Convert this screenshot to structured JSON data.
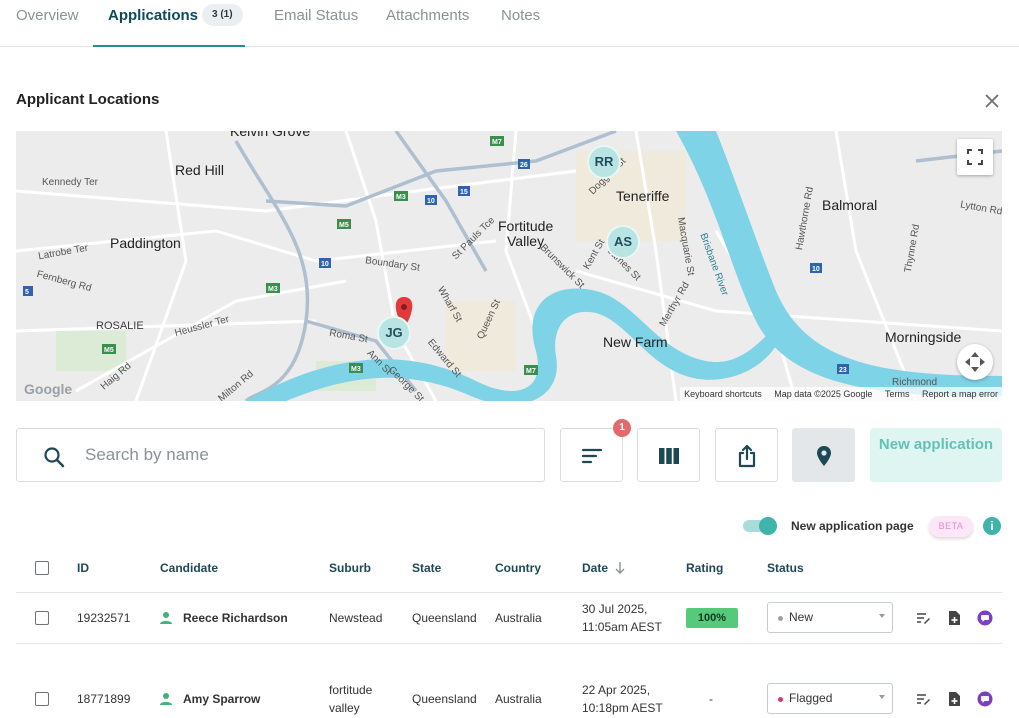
{
  "tabs": [
    {
      "label": "Overview"
    },
    {
      "label": "Applications",
      "badge": "3 (1)"
    },
    {
      "label": "Email Status"
    },
    {
      "label": "Attachments"
    },
    {
      "label": "Notes"
    }
  ],
  "section": {
    "title": "Applicant Locations"
  },
  "map": {
    "places": [
      "Kelvin Grove",
      "Red Hill",
      "Paddington",
      "ROSALIE",
      "Fortitude",
      "Valley",
      "Teneriffe",
      "New Farm",
      "Balmoral",
      "Morningside"
    ],
    "streets": [
      "Kennedy Ter",
      "Latrobe Ter",
      "Fernberg Rd",
      "Boundary St",
      "St Pauls Tce",
      "Brunswick St",
      "James St",
      "Doggett St",
      "Wharf St",
      "Queen St",
      "Roma St",
      "Ann St",
      "Edward St",
      "George St",
      "Heussler Ter",
      "Haig Rd",
      "Milton Rd",
      "Kent St",
      "Merthyr Rd",
      "Macquarie St",
      "Hawthorne Rd",
      "Thynne Rd",
      "Lytton Rd",
      "Richmond",
      "Brisbane River"
    ],
    "route_shields": [
      "M3",
      "M5",
      "M7",
      "26",
      "15",
      "10",
      "5",
      "23",
      "M3",
      "M5",
      "M3",
      "M3",
      "M7",
      "10"
    ],
    "clusters": [
      {
        "label": "RR"
      },
      {
        "label": "AS"
      },
      {
        "label": "JG"
      }
    ],
    "google": "Google",
    "attribution": [
      "Keyboard shortcuts",
      "Map data ©2025 Google",
      "Terms",
      "Report a map error"
    ],
    "colors": {
      "water": "#7fd3e6",
      "land": "#ececec",
      "road": "#ffffff",
      "highway": "#aebfd0",
      "cluster": "#b9e4e4",
      "pin": "#e03a3a"
    }
  },
  "search": {
    "placeholder": "Search by name",
    "value": ""
  },
  "toolbar": {
    "filter_count": "1",
    "new_application": "New application",
    "icons": [
      "sort-icon",
      "columns-icon",
      "share-icon",
      "location-pin-icon"
    ]
  },
  "toggle": {
    "label": "New application page",
    "on": true,
    "beta": "BETA",
    "info": "i"
  },
  "table": {
    "columns": [
      "ID",
      "Candidate",
      "Suburb",
      "State",
      "Country",
      "Date",
      "Rating",
      "Status"
    ],
    "rows": [
      {
        "id": "19232571",
        "candidate": "Reece Richardson",
        "suburb": "Newstead",
        "suburb_line2": "",
        "state": "Queensland",
        "country": "Australia",
        "date_line1": "30 Jul 2025,",
        "date_line2": "11:05am AEST",
        "rating": "100%",
        "status": "New",
        "status_color": "#9aa0a6"
      },
      {
        "id": "18771899",
        "candidate": "Amy Sparrow",
        "suburb": "fortitude",
        "suburb_line2": "valley",
        "state": "Queensland",
        "country": "Australia",
        "date_line1": "22 Apr 2025,",
        "date_line2": "10:18pm AEST",
        "rating": "-",
        "status": "Flagged",
        "status_color": "#e0337a"
      }
    ]
  }
}
